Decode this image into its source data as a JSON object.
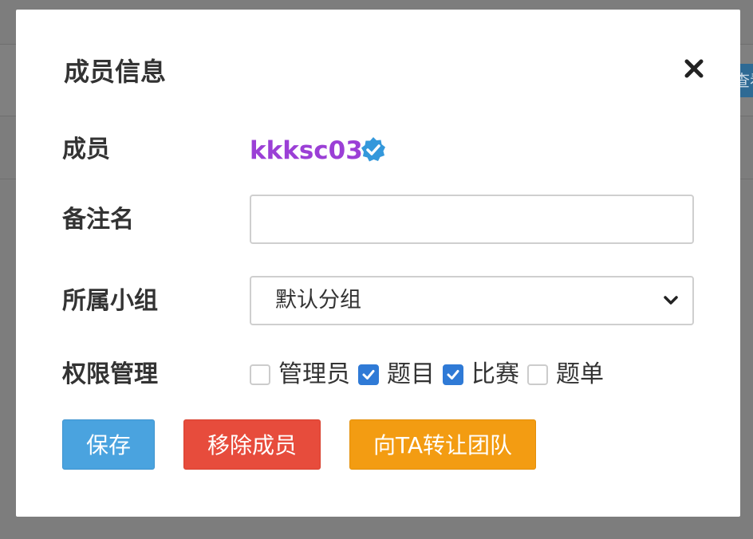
{
  "background": {
    "partial_button_text": "查看"
  },
  "modal": {
    "title": "成员信息",
    "close_icon": "close-icon"
  },
  "form": {
    "member": {
      "label": "成员",
      "username": "kkksc03",
      "username_color": "#9b3fd6",
      "badge_icon": "verified-badge-icon",
      "badge_color": "#3498db"
    },
    "remark": {
      "label": "备注名",
      "value": "",
      "placeholder": ""
    },
    "group": {
      "label": "所属小组",
      "selected": "默认分组"
    },
    "permissions": {
      "label": "权限管理",
      "items": [
        {
          "label": "管理员",
          "checked": false
        },
        {
          "label": "题目",
          "checked": true
        },
        {
          "label": "比赛",
          "checked": true
        },
        {
          "label": "题单",
          "checked": false
        }
      ]
    }
  },
  "buttons": {
    "save": {
      "label": "保存",
      "color": "#4aa3df"
    },
    "remove": {
      "label": "移除成员",
      "color": "#e74c3c"
    },
    "transfer": {
      "label": "向TA转让团队",
      "color": "#f39c12"
    }
  }
}
